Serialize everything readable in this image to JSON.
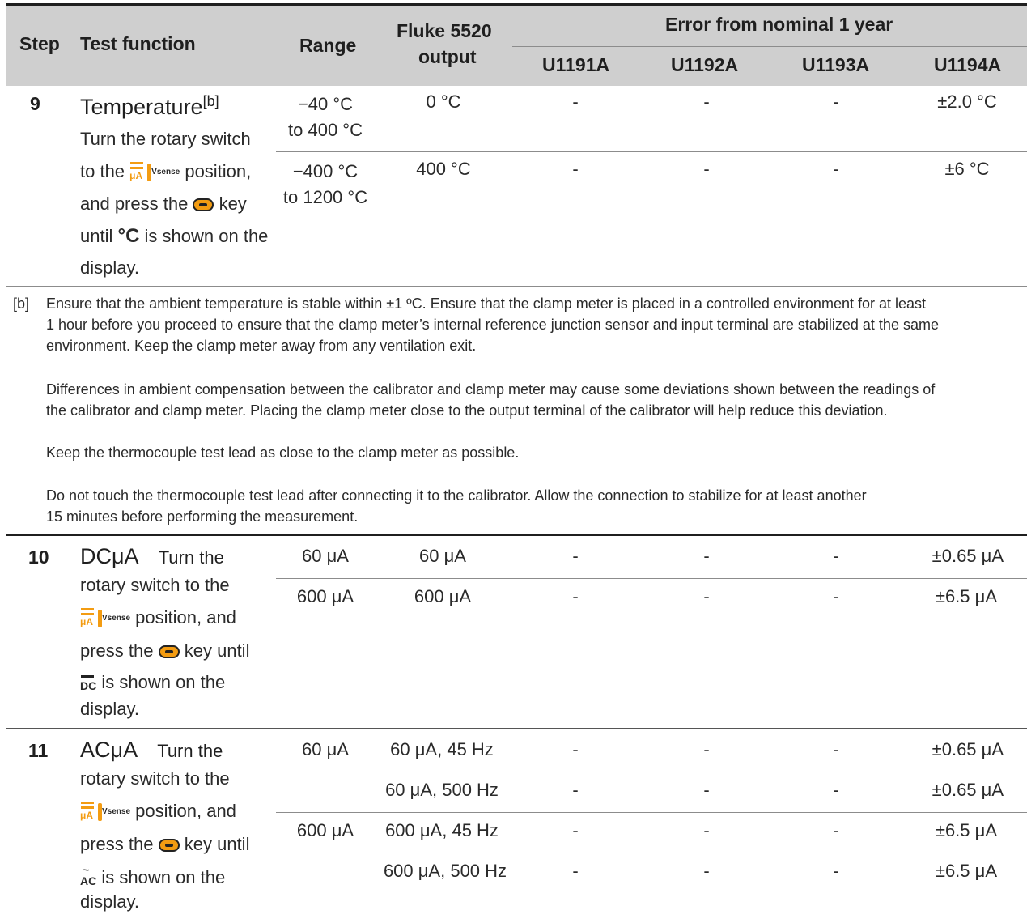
{
  "header": {
    "step": "Step",
    "test_function": "Test function",
    "range": "Range",
    "fluke_line1": "Fluke 5520",
    "fluke_line2": "output",
    "error_group": "Error from nominal 1 year",
    "models": [
      "U1191A",
      "U1192A",
      "U1193A",
      "U1194A"
    ]
  },
  "step9": {
    "num": "9",
    "title": "Temperature",
    "title_sup": "[b]",
    "line1": "Turn the rotary switch",
    "line2a": "to the",
    "line2b": "position,",
    "line3a": "and press the",
    "line3b": "key",
    "line4a": "until",
    "line4b": "is shown on the",
    "line5": "display.",
    "rows": [
      {
        "range1": "−40 °C",
        "range2": "to 400 °C",
        "out": "0 °C",
        "e1": "-",
        "e2": "-",
        "e3": "-",
        "e4": "±2.0 °C"
      },
      {
        "range1": "−400 °C",
        "range2": "to 1200 °C",
        "out": "400 °C",
        "e1": "-",
        "e2": "-",
        "e3": "-",
        "e4": "±6 °C"
      }
    ]
  },
  "note": {
    "tag": "[b]",
    "p1a": "Ensure that the ambient temperature is stable within ±1 ºC. Ensure that the clamp meter is placed in a controlled environment for at least",
    "p1b": "1 hour before you proceed to ensure that the clamp meter’s internal reference junction sensor and input terminal are stabilized at the same",
    "p1c": "environment. Keep the clamp meter away from any ventilation exit.",
    "p2a": "Differences in ambient compensation between the calibrator and clamp meter may cause some deviations shown between the readings of",
    "p2b": "the calibrator and clamp meter. Placing the clamp meter close to the output terminal of the calibrator will help reduce this deviation.",
    "p3": "Keep the thermocouple test lead as close to the clamp meter as possible.",
    "p4a": "Do not touch the thermocouple test lead after connecting it to the calibrator. Allow the connection to stabilize for at least another",
    "p4b": "15 minutes before performing the measurement."
  },
  "step10": {
    "num": "10",
    "title": "DCμA",
    "l1": "Turn the",
    "l2": "rotary switch to the",
    "l3": "position, and",
    "l4a": "press the",
    "l4b": "key until",
    "l5": "is shown on the",
    "l6": "display.",
    "rows": [
      {
        "range": "60 μA",
        "out": "60 μA",
        "e1": "-",
        "e2": "-",
        "e3": "-",
        "e4": "±0.65 μA"
      },
      {
        "range": "600 μA",
        "out": "600 μA",
        "e1": "-",
        "e2": "-",
        "e3": "-",
        "e4": "±6.5 μA"
      }
    ]
  },
  "step11": {
    "num": "11",
    "title": "ACμA",
    "l1": "Turn the",
    "l2": "rotary switch to the",
    "l3": "position, and",
    "l4a": "press the",
    "l4b": "key until",
    "l5": "is shown on the",
    "l6": "display.",
    "range_a": "60 μA",
    "range_b": "600 μA",
    "rows": [
      {
        "out": "60 μA, 45 Hz",
        "e1": "-",
        "e2": "-",
        "e3": "-",
        "e4": "±0.65 μA"
      },
      {
        "out": "60 μA, 500 Hz",
        "e1": "-",
        "e2": "-",
        "e3": "-",
        "e4": "±0.65 μA"
      },
      {
        "out": "600 μA, 45 Hz",
        "e1": "-",
        "e2": "-",
        "e3": "-",
        "e4": "±6.5 μA"
      },
      {
        "out": "600 μA, 500 Hz",
        "e1": "-",
        "e2": "-",
        "e3": "-",
        "e4": "±6.5 μA"
      }
    ]
  },
  "icons": {
    "rotary_position": "ac-dc-microamp-temperature-vsense-icon",
    "shift_key": "shift-key-icon",
    "degree_c": "degree-celsius-icon",
    "dc": "dc-indicator-icon",
    "ac": "ac-indicator-icon",
    "vsense_label": "Vsense"
  },
  "colors": {
    "header_bg": "#cfcfcf",
    "accent_orange": "#f39c12",
    "rule": "#8c8c8c"
  }
}
